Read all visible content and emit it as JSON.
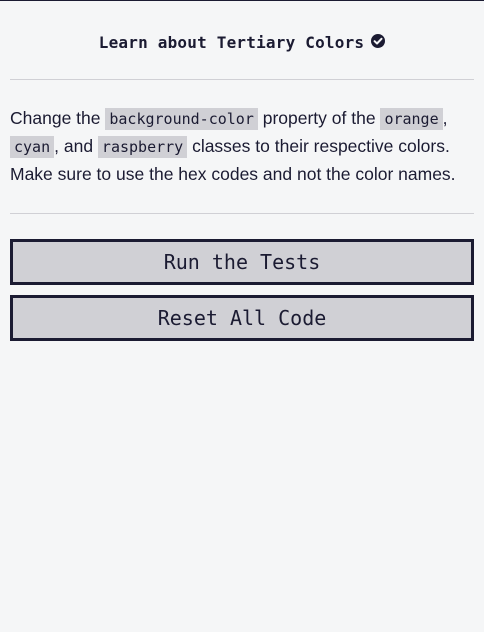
{
  "challenge": {
    "title": "Learn about Tertiary Colors",
    "completed_icon": "check-circle-icon"
  },
  "description": {
    "part1": "Change the ",
    "code1": "background-color",
    "part2": " property of the ",
    "code2": "orange",
    "part3": ", ",
    "code3": "cyan",
    "part4": ", and ",
    "code4": "raspberry",
    "part5": " classes to their respective colors. Make sure to use the hex codes and not the color names."
  },
  "buttons": {
    "run_label": "Run the Tests",
    "reset_label": "Reset All Code"
  },
  "colors": {
    "background": "#f5f6f7",
    "text": "#1b1b32",
    "button_bg": "#d0d0d5",
    "divider": "#d0d0d5"
  }
}
